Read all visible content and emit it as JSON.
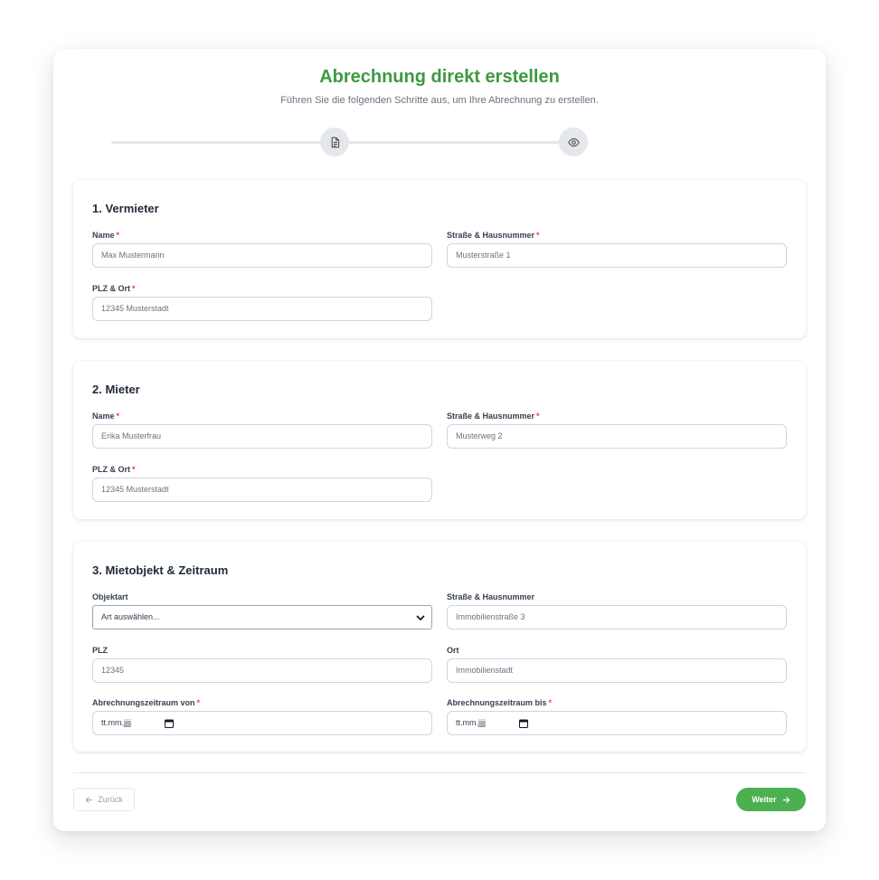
{
  "header": {
    "title": "Abrechnung direkt erstellen",
    "subtitle": "Führen Sie die folgenden Schritte aus, um Ihre Abrechnung zu erstellen."
  },
  "steps": [
    {
      "icon": "document-icon"
    },
    {
      "icon": "eye-icon"
    }
  ],
  "required_marker": "*",
  "sections": {
    "landlord": {
      "title": "1. Vermieter",
      "name": {
        "label": "Name",
        "placeholder": "Max Mustermann"
      },
      "street": {
        "label": "Straße & Hausnummer",
        "placeholder": "Musterstraße 1"
      },
      "zip_city": {
        "label": "PLZ & Ort",
        "placeholder": "12345 Musterstadt"
      }
    },
    "tenant": {
      "title": "2. Mieter",
      "name": {
        "label": "Name",
        "placeholder": "Erika Musterfrau"
      },
      "street": {
        "label": "Straße & Hausnummer",
        "placeholder": "Musterweg 2"
      },
      "zip_city": {
        "label": "PLZ & Ort",
        "placeholder": "12345 Musterstadt"
      }
    },
    "property": {
      "title": "3. Mietobjekt & Zeitraum",
      "type": {
        "label": "Objektart",
        "value": "Art auswählen..."
      },
      "street": {
        "label": "Straße & Hausnummer",
        "placeholder": "Immobilienstraße 3"
      },
      "zip": {
        "label": "PLZ",
        "placeholder": "12345"
      },
      "city": {
        "label": "Ort",
        "placeholder": "Immobilienstadt"
      },
      "period_from": {
        "label": "Abrechnungszeitraum von",
        "value": "tt.mm.jjjj"
      },
      "period_to": {
        "label": "Abrechnungszeitraum bis",
        "value": "tt.mm.jjjj"
      }
    }
  },
  "footer": {
    "back_label": "Zurück",
    "next_label": "Weiter"
  },
  "colors": {
    "accent": "#3d9a3f",
    "button": "#4caf50",
    "required": "#ef4444"
  }
}
